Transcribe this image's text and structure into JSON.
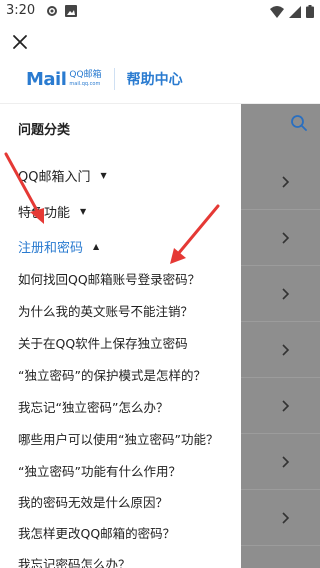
{
  "status_bar": {
    "time": "3:20"
  },
  "logo": {
    "mail": "Mail",
    "qq": "QQ邮箱",
    "domain": "mail.qq.com",
    "help_center": "帮助中心"
  },
  "drawer": {
    "title": "问题分类",
    "categories": [
      {
        "label": "QQ邮箱入门"
      },
      {
        "label": "特色功能"
      },
      {
        "label": "注册和密码"
      }
    ],
    "questions": [
      "如何找回QQ邮箱账号登录密码？",
      "为什么我的英文账号不能注销？",
      "关于在QQ软件上保存独立密码",
      "“独立密码”的保护模式是怎样的？",
      "我忘记“独立密码”怎么办？",
      "哪些用户可以使用“独立密码”功能？",
      "“独立密码”功能有什么作用？",
      "我的密码无效是什么原因？",
      "我怎样更改QQ邮箱的密码？",
      "我忘记密码怎么办？"
    ]
  },
  "colors": {
    "accent": "#2a7bd0",
    "overlay": "#8e8e8e",
    "annotation_arrow": "#e53935"
  },
  "icons": [
    "close-icon",
    "search-icon",
    "chevron-right-icon",
    "triangle-down-icon",
    "triangle-up-icon",
    "wifi-icon",
    "battery-icon"
  ]
}
